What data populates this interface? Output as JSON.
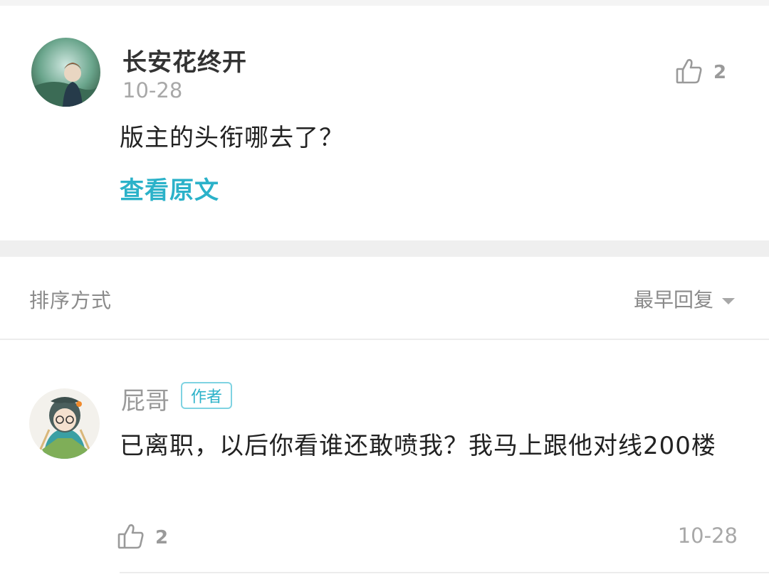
{
  "comment": {
    "username": "长安花终开",
    "date": "10-28",
    "likes": "2",
    "text": "版主的头衔哪去了？",
    "view_original": "查看原文"
  },
  "sort": {
    "label": "排序方式",
    "selected": "最早回复"
  },
  "reply": {
    "username": "屁哥",
    "badge": "作者",
    "text": "已离职，以后你看谁还敢喷我？我马上跟他对线200楼",
    "likes": "2",
    "date": "10-28"
  },
  "icons": {
    "like": "thumbs-up-icon",
    "dropdown": "caret-down-icon"
  },
  "colors": {
    "accent": "#2bb2c9",
    "muted": "#a8a8a8",
    "band": "#efefef"
  }
}
